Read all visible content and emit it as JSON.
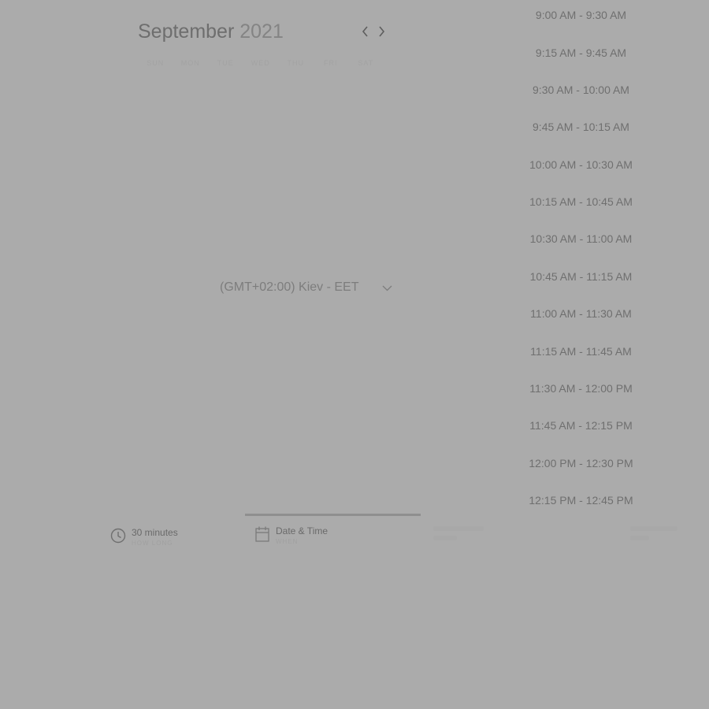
{
  "calendar": {
    "month": "September",
    "year": "2021",
    "prev_icon": "chevron-left-icon",
    "next_icon": "chevron-right-icon",
    "weekdays": [
      "SUN",
      "MON",
      "TUE",
      "WED",
      "THU",
      "FRI",
      "SAT"
    ]
  },
  "timezone": {
    "label": "(GMT+02:00) Kiev - EET",
    "icon": "chevron-down-icon"
  },
  "time_slots": [
    "9:00 AM - 9:30 AM",
    "9:15 AM - 9:45 AM",
    "9:30 AM - 10:00 AM",
    "9:45 AM - 10:15 AM",
    "10:00 AM - 10:30 AM",
    "10:15 AM - 10:45 AM",
    "10:30 AM - 11:00 AM",
    "10:45 AM - 11:15 AM",
    "11:00 AM - 11:30 AM",
    "11:15 AM - 11:45 AM",
    "11:30 AM - 12:00 PM",
    "11:45 AM - 12:15 PM",
    "12:00 PM - 12:30 PM",
    "12:15 PM - 12:45 PM"
  ],
  "steps": {
    "duration": {
      "title": "30 minutes",
      "subtitle": "HOW LONG",
      "icon": "clock-icon"
    },
    "datetime": {
      "title": "Date & Time",
      "subtitle": "WHEN",
      "icon": "calendar-icon"
    }
  },
  "colors": {
    "overlay": "#ababab",
    "text": "#6f6f6f"
  }
}
